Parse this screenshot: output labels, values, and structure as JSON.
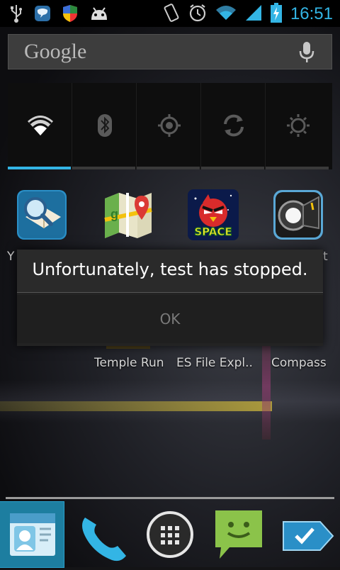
{
  "status_bar": {
    "time": "16:51",
    "left_icons": [
      "usb-icon",
      "chat-bubble-icon",
      "shield-icon",
      "android-icon"
    ],
    "right_icons": [
      "vibrate-icon",
      "alarm-icon",
      "wifi-icon",
      "signal-icon",
      "battery-charging-icon"
    ],
    "accent_color": "#33b5e5"
  },
  "search": {
    "logo_text": "Google",
    "mic_icon": "mic-icon"
  },
  "power_widget": {
    "toggles": [
      {
        "name": "wifi",
        "icon": "wifi-icon",
        "on": true
      },
      {
        "name": "bluetooth",
        "icon": "bluetooth-icon",
        "on": false
      },
      {
        "name": "gps",
        "icon": "gps-icon",
        "on": false
      },
      {
        "name": "sync",
        "icon": "sync-icon",
        "on": false
      },
      {
        "name": "brightness",
        "icon": "brightness-icon",
        "on": false
      }
    ]
  },
  "home": {
    "apps_row1": [
      {
        "icon": "search-book-icon"
      },
      {
        "icon": "maps-icon"
      },
      {
        "icon": "angry-birds-space-icon",
        "badge_text": "SPACE"
      },
      {
        "icon": "flashlight-icon"
      }
    ],
    "row1_label_fragments": {
      "left": "Y",
      "right": "t"
    },
    "apps_row2_labels": [
      "Temple Run",
      "ES File Expl..",
      "Compass"
    ]
  },
  "dialog": {
    "title": "Unfortunately, test has stopped.",
    "ok_label": "OK"
  },
  "dock": {
    "items": [
      {
        "icon": "contacts-icon",
        "selected": true
      },
      {
        "icon": "phone-icon",
        "selected": false
      },
      {
        "icon": "app-drawer-icon",
        "selected": false
      },
      {
        "icon": "messaging-icon",
        "selected": false
      },
      {
        "icon": "email-tag-icon",
        "selected": false
      }
    ]
  }
}
